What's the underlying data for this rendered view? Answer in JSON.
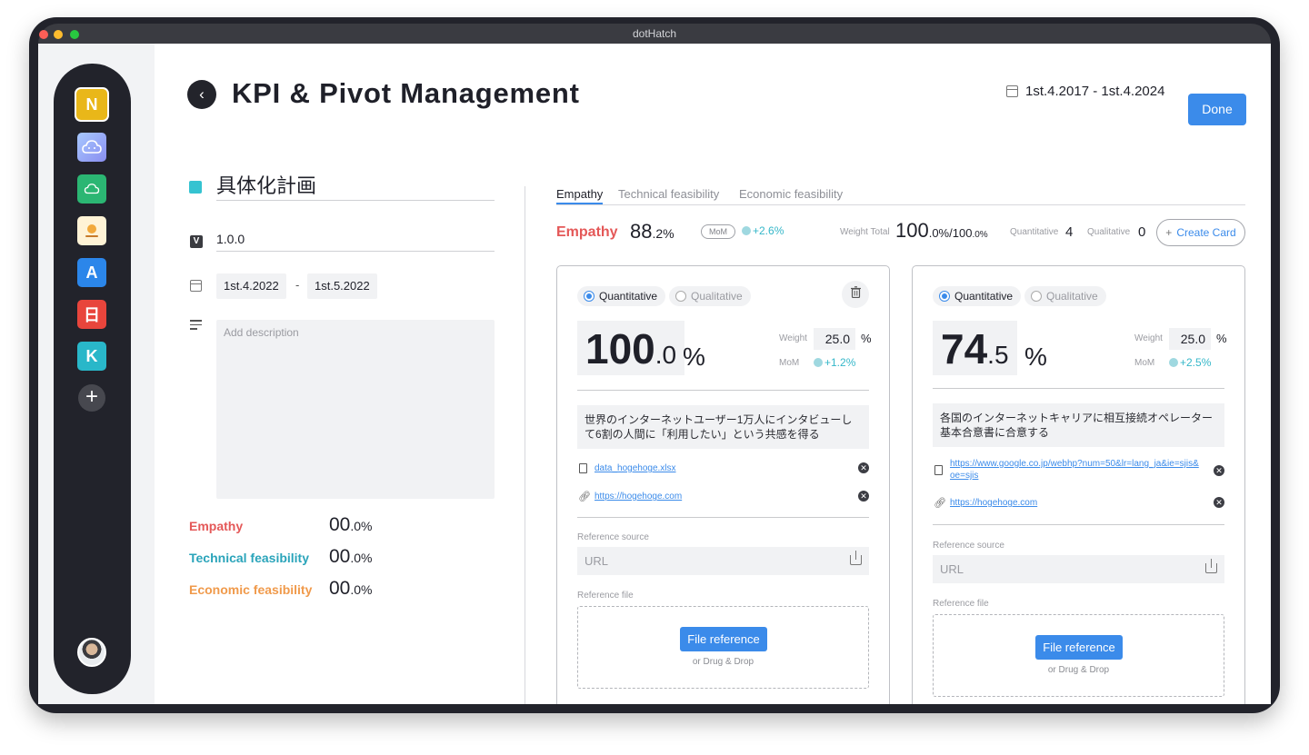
{
  "window": {
    "title": "dotHatch"
  },
  "header": {
    "title": "KPI & Pivot Management",
    "date_range": "1st.4.2017 - 1st.4.2024",
    "done_label": "Done"
  },
  "sidebar": {
    "apps": [
      {
        "letter": "N",
        "color": "#e9b719"
      },
      {
        "letter": "",
        "color": "#8fb7f5"
      },
      {
        "letter": "",
        "color": "#2bb673"
      },
      {
        "letter": "",
        "color": "#fff3d6"
      },
      {
        "letter": "A",
        "color": "#2b86ea"
      },
      {
        "letter": "日",
        "color": "#e8453c"
      },
      {
        "letter": "K",
        "color": "#29b7c9"
      }
    ],
    "add_label": "+"
  },
  "plan": {
    "title": "具体化計画",
    "version_badge": "V",
    "version": "1.0.0",
    "start_date": "1st.4.2022",
    "date_sep": "-",
    "end_date": "1st.5.2022",
    "description_placeholder": "Add description",
    "metrics": [
      {
        "label": "Empathy",
        "whole": "00",
        "dec": ".0%",
        "color": "#e45858"
      },
      {
        "label": "Technical feasibility",
        "whole": "00",
        "dec": ".0%",
        "color": "#2aa4ba"
      },
      {
        "label": "Economic feasibility",
        "whole": "00",
        "dec": ".0%",
        "color": "#f09a4b"
      }
    ]
  },
  "tabs": [
    "Empathy",
    "Technical feasibility",
    "Economic feasibility"
  ],
  "summary": {
    "label": "Empathy",
    "value_whole": "88",
    "value_dec": ".2%",
    "mom_label": "MoM",
    "mom_delta": "+2.6%",
    "weight_total_label": "Weight Total",
    "weight_total_whole": "100",
    "weight_total_dec": ".0%",
    "weight_total_max": "/100",
    "weight_total_max_dec": ".0%",
    "quantitative_label": "Quantitative",
    "quantitative_count": "4",
    "qualitative_label": "Qualitative",
    "qualitative_count": "0",
    "create_label": "Create Card",
    "create_plus": "+"
  },
  "cards": [
    {
      "quantitative": "Quantitative",
      "qualitative": "Qualitative",
      "value_whole": "100",
      "value_dec": ".0",
      "unit": "%",
      "weight_label": "Weight",
      "weight": "25.0",
      "weight_unit": "%",
      "mom_label": "MoM",
      "mom_delta": "+1.2%",
      "goal": "世界のインターネットユーザー1万人にインタビューして6割の人間に「利用したい」という共感を得る",
      "file": "data_hogehoge.xlsx",
      "link": "https://hogehoge.com",
      "ref_source_label": "Reference source",
      "url_placeholder": "URL",
      "ref_file_label": "Reference file",
      "file_button": "File reference",
      "drop_hint": "or Drug & Drop"
    },
    {
      "quantitative": "Quantitative",
      "qualitative": "Qualitative",
      "value_whole": "74",
      "value_dec": ".5",
      "unit": "%",
      "weight_label": "Weight",
      "weight": "25.0",
      "weight_unit": "%",
      "mom_label": "MoM",
      "mom_delta": "+2.5%",
      "goal": "各国のインターネットキャリアに相互接続オペレーター基本合意書に合意する",
      "file": "https://www.google.co.jp/webhp?num=50&lr=lang_ja&ie=sjis&oe=sjis",
      "link": "https://hogehoge.com",
      "ref_source_label": "Reference source",
      "url_placeholder": "URL",
      "ref_file_label": "Reference file",
      "file_button": "File reference",
      "drop_hint": "or Drug & Drop"
    }
  ]
}
